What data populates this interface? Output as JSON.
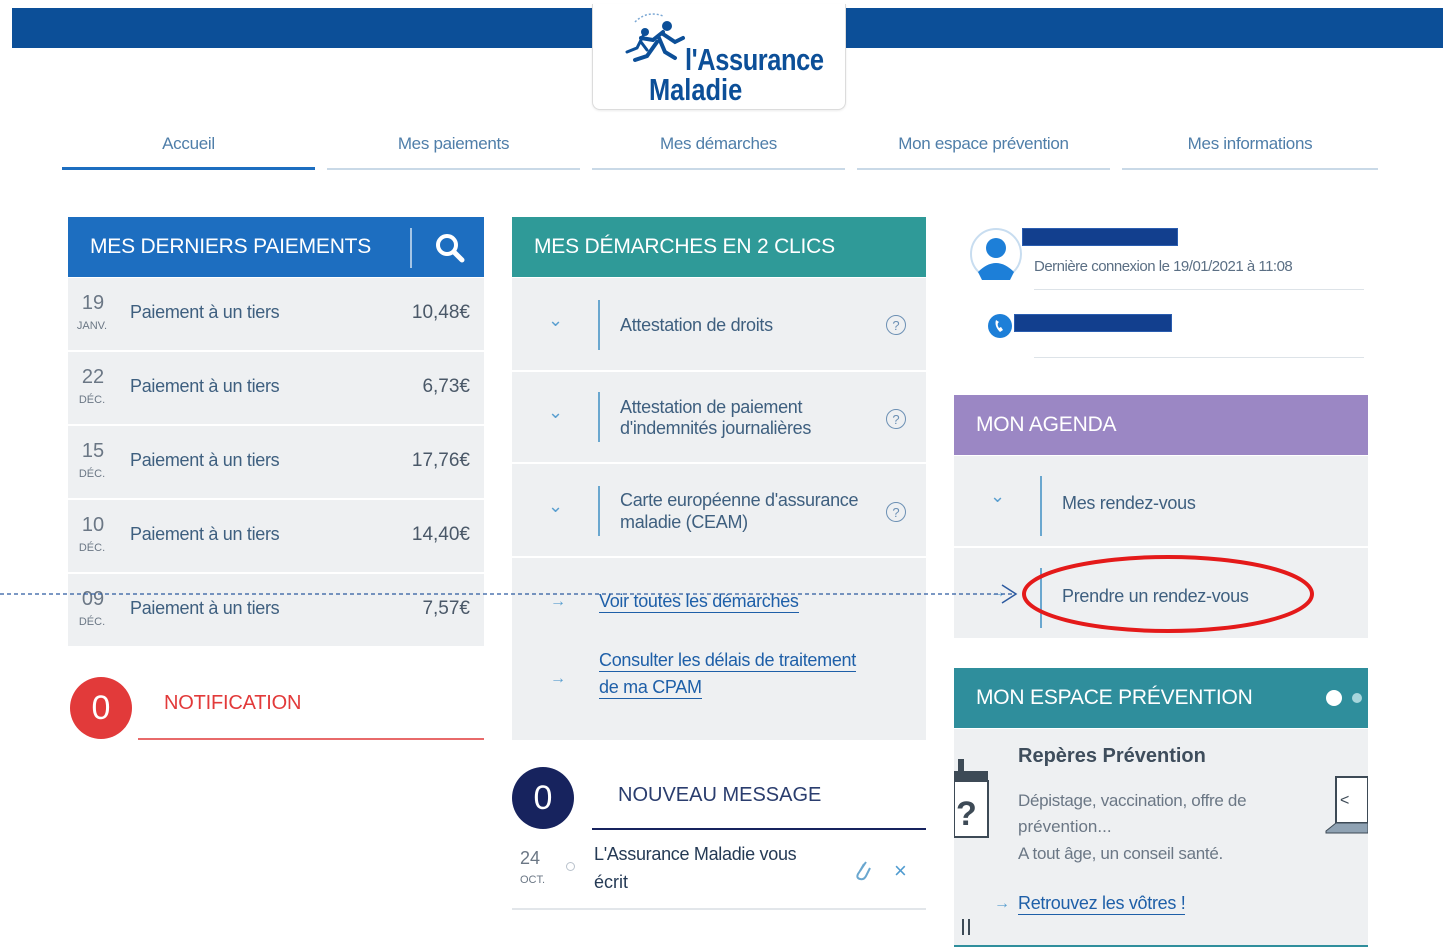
{
  "header": {
    "logo_line1": "l'Assurance",
    "logo_line2": "Maladie",
    "brand_color": "#0c4f98"
  },
  "nav": {
    "tabs": [
      {
        "label": "Accueil",
        "active": true
      },
      {
        "label": "Mes paiements"
      },
      {
        "label": "Mes démarches"
      },
      {
        "label": "Mon espace prévention"
      },
      {
        "label": "Mes informations"
      }
    ]
  },
  "payments": {
    "title": "MES DERNIERS PAIEMENTS",
    "rows": [
      {
        "day": "19",
        "month": "JANV.",
        "label": "Paiement à un tiers",
        "amount": "10,48€"
      },
      {
        "day": "22",
        "month": "DÉC.",
        "label": "Paiement à un tiers",
        "amount": "6,73€"
      },
      {
        "day": "15",
        "month": "DÉC.",
        "label": "Paiement à un tiers",
        "amount": "17,76€"
      },
      {
        "day": "10",
        "month": "DÉC.",
        "label": "Paiement à un tiers",
        "amount": "14,40€"
      },
      {
        "day": "09",
        "month": "DÉC.",
        "label": "Paiement à un tiers",
        "amount": "7,57€"
      }
    ]
  },
  "notification": {
    "count": "0",
    "label": "NOTIFICATION"
  },
  "demarches": {
    "title": "MES DÉMARCHES EN 2 CLICS",
    "items": [
      {
        "label": "Attestation de droits"
      },
      {
        "label1": "Attestation de paiement",
        "label2": "d'indemnités journalières"
      },
      {
        "label1": "Carte européenne d'assurance",
        "label2": "maladie (CEAM)"
      }
    ],
    "link_all": "Voir toutes les démarches",
    "link_delays_1": "Consulter les délais de traitement",
    "link_delays_2": "de ma CPAM"
  },
  "message": {
    "count": "0",
    "title": "NOUVEAU MESSAGE",
    "day": "24",
    "month": "OCT.",
    "text1": "L'Assurance Maladie vous",
    "text2": "écrit"
  },
  "profile": {
    "last_login": "Dernière connexion le 19/01/2021 à 11:08"
  },
  "agenda": {
    "title": "MON AGENDA",
    "item1": "Mes rendez-vous",
    "item2": "Prendre un rendez-vous"
  },
  "prevention": {
    "title": "MON ESPACE PRÉVENTION",
    "card_title": "Repères Prévention",
    "desc1": "Dépistage, vaccination, offre de",
    "desc2": "prévention...",
    "desc3": "A tout âge, un conseil santé.",
    "link": "Retrouvez les vôtres !"
  },
  "colors": {
    "payments_header": "#1d6ec0",
    "demarches_header": "#2f9a98",
    "agenda_header": "#9b87c4",
    "prevention_header": "#2f8e9c",
    "notification_badge": "#e23a3a",
    "message_badge": "#17235e",
    "annotation_red": "#e41a1a"
  }
}
